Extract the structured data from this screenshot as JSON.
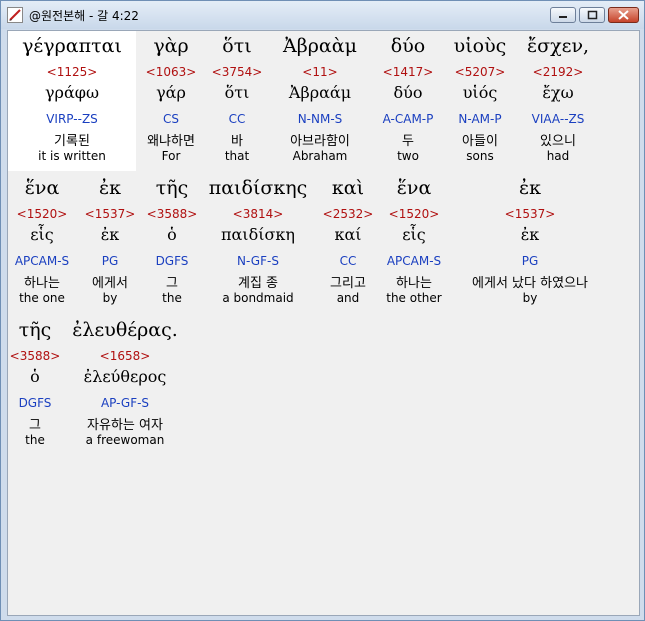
{
  "window": {
    "title": "@원전본해 - 갈 4:22",
    "minimize_glyph": "—",
    "maximize_glyph": "□",
    "close_glyph": "✕"
  },
  "words": [
    {
      "greek": "γέγραπται",
      "strong": "<1125>",
      "lemma": "γράφω",
      "parsing": "VIRP--ZS",
      "korean": "기록된",
      "english": "it is written"
    },
    {
      "greek": "γὰρ",
      "strong": "<1063>",
      "lemma": "γάρ",
      "parsing": "CS",
      "korean": "왜냐하면",
      "english": "For"
    },
    {
      "greek": "ὅτι",
      "strong": "<3754>",
      "lemma": "ὅτι",
      "parsing": "CC",
      "korean": "바",
      "english": "that"
    },
    {
      "greek": "Ἀβραὰμ",
      "strong": "<11>",
      "lemma": "Ἀβραάμ",
      "parsing": "N-NM-S",
      "korean": "아브라함이",
      "english": "Abraham"
    },
    {
      "greek": "δύο",
      "strong": "<1417>",
      "lemma": "δύο",
      "parsing": "A-CAM-P",
      "korean": "두",
      "english": "two"
    },
    {
      "greek": "υἱοὺς",
      "strong": "<5207>",
      "lemma": "υἱός",
      "parsing": "N-AM-P",
      "korean": "아들이",
      "english": "sons"
    },
    {
      "greek": "ἔσχεν,",
      "strong": "<2192>",
      "lemma": "ἔχω",
      "parsing": "VIAA--ZS",
      "korean": "있으니",
      "english": "had"
    },
    {
      "greek": "ἕνα",
      "strong": "<1520>",
      "lemma": "εἷς",
      "parsing": "APCAM-S",
      "korean": "하나는",
      "english": "the one"
    },
    {
      "greek": "ἐκ",
      "strong": "<1537>",
      "lemma": "ἐκ",
      "parsing": "PG",
      "korean": "에게서",
      "english": "by"
    },
    {
      "greek": "τῆς",
      "strong": "<3588>",
      "lemma": "ὁ",
      "parsing": "DGFS",
      "korean": "그",
      "english": "the"
    },
    {
      "greek": "παιδίσκης",
      "strong": "<3814>",
      "lemma": "παιδίσκη",
      "parsing": "N-GF-S",
      "korean": "계집 종",
      "english": "a bondmaid"
    },
    {
      "greek": "καὶ",
      "strong": "<2532>",
      "lemma": "καί",
      "parsing": "CC",
      "korean": "그리고",
      "english": "and"
    },
    {
      "greek": "ἕνα",
      "strong": "<1520>",
      "lemma": "εἷς",
      "parsing": "APCAM-S",
      "korean": "하나는",
      "english": "the other"
    },
    {
      "greek": "ἐκ",
      "strong": "<1537>",
      "lemma": "ἐκ",
      "parsing": "PG",
      "korean": "에게서 났다 하였으나",
      "english": "by"
    },
    {
      "greek": "τῆς",
      "strong": "<3588>",
      "lemma": "ὁ",
      "parsing": "DGFS",
      "korean": "그",
      "english": "the"
    },
    {
      "greek": "ἐλευθέρας.",
      "strong": "<1658>",
      "lemma": "ἐλεύθερος",
      "parsing": "AP-GF-S",
      "korean": "자유하는 여자",
      "english": "a freewoman"
    }
  ]
}
